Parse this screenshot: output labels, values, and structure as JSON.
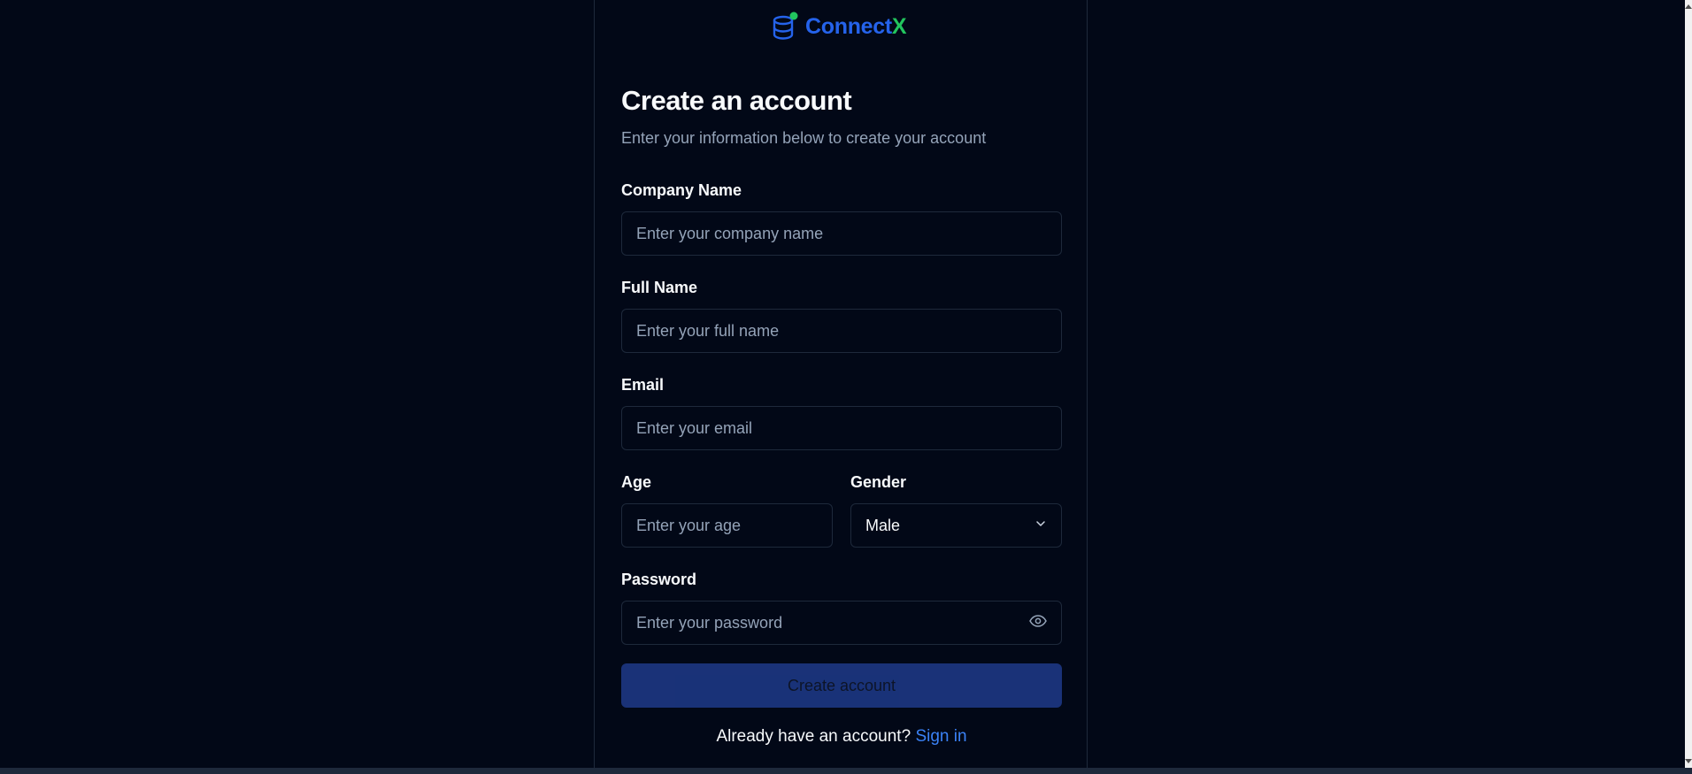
{
  "brand": {
    "name_main": "Connect",
    "name_accent": "X",
    "colors": {
      "primary": "#2563eb",
      "accent": "#22c55e"
    }
  },
  "form": {
    "title": "Create an account",
    "subtitle": "Enter your information below to create your account",
    "company": {
      "label": "Company Name",
      "placeholder": "Enter your company name"
    },
    "full_name": {
      "label": "Full Name",
      "placeholder": "Enter your full name"
    },
    "email": {
      "label": "Email",
      "placeholder": "Enter your email"
    },
    "age": {
      "label": "Age",
      "placeholder": "Enter your age"
    },
    "gender": {
      "label": "Gender",
      "value": "Male",
      "icon": "chevron-down-icon"
    },
    "password": {
      "label": "Password",
      "placeholder": "Enter your password",
      "icon": "eye-icon"
    },
    "submit_label": "Create account"
  },
  "footer": {
    "prompt": "Already have an account?",
    "link": "Sign in"
  }
}
